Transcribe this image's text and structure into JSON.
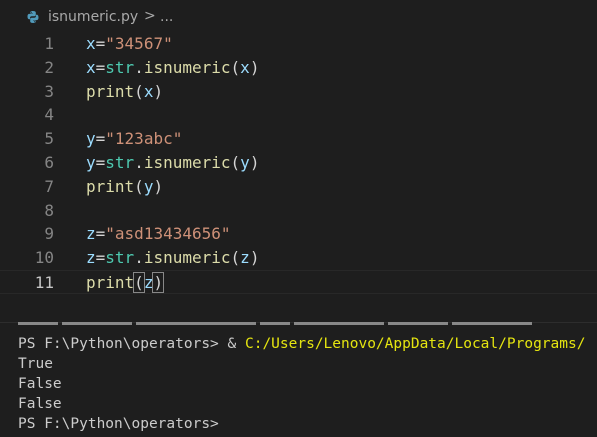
{
  "breadcrumb": {
    "icon": "python-file-icon",
    "file_name": "isnumeric.py",
    "separator": ">",
    "more": "..."
  },
  "editor": {
    "lines": [
      {
        "num": "1",
        "tokens": [
          {
            "t": "x",
            "c": "v"
          },
          {
            "t": "=",
            "c": "p"
          },
          {
            "t": "\"34567\"",
            "c": "s"
          }
        ]
      },
      {
        "num": "2",
        "tokens": [
          {
            "t": "x",
            "c": "v"
          },
          {
            "t": "=",
            "c": "p"
          },
          {
            "t": "str",
            "c": "cls"
          },
          {
            "t": ".",
            "c": "p"
          },
          {
            "t": "isnumeric",
            "c": "fn"
          },
          {
            "t": "(",
            "c": "p"
          },
          {
            "t": "x",
            "c": "v"
          },
          {
            "t": ")",
            "c": "p"
          }
        ]
      },
      {
        "num": "3",
        "tokens": [
          {
            "t": "print",
            "c": "fn"
          },
          {
            "t": "(",
            "c": "p"
          },
          {
            "t": "x",
            "c": "v"
          },
          {
            "t": ")",
            "c": "p"
          }
        ]
      },
      {
        "num": "4",
        "tokens": []
      },
      {
        "num": "5",
        "tokens": [
          {
            "t": "y",
            "c": "v"
          },
          {
            "t": "=",
            "c": "p"
          },
          {
            "t": "\"123abc\"",
            "c": "s"
          }
        ]
      },
      {
        "num": "6",
        "tokens": [
          {
            "t": "y",
            "c": "v"
          },
          {
            "t": "=",
            "c": "p"
          },
          {
            "t": "str",
            "c": "cls"
          },
          {
            "t": ".",
            "c": "p"
          },
          {
            "t": "isnumeric",
            "c": "fn"
          },
          {
            "t": "(",
            "c": "p"
          },
          {
            "t": "y",
            "c": "v"
          },
          {
            "t": ")",
            "c": "p"
          }
        ]
      },
      {
        "num": "7",
        "tokens": [
          {
            "t": "print",
            "c": "fn"
          },
          {
            "t": "(",
            "c": "p"
          },
          {
            "t": "y",
            "c": "v"
          },
          {
            "t": ")",
            "c": "p"
          }
        ]
      },
      {
        "num": "8",
        "tokens": []
      },
      {
        "num": "9",
        "tokens": [
          {
            "t": "z",
            "c": "v"
          },
          {
            "t": "=",
            "c": "p"
          },
          {
            "t": "\"asd13434656\"",
            "c": "s"
          }
        ]
      },
      {
        "num": "10",
        "tokens": [
          {
            "t": "z",
            "c": "v"
          },
          {
            "t": "=",
            "c": "p"
          },
          {
            "t": "str",
            "c": "cls"
          },
          {
            "t": ".",
            "c": "p"
          },
          {
            "t": "isnumeric",
            "c": "fn"
          },
          {
            "t": "(",
            "c": "p"
          },
          {
            "t": "z",
            "c": "v"
          },
          {
            "t": ")",
            "c": "p"
          }
        ]
      },
      {
        "num": "11",
        "tokens": [
          {
            "t": "print",
            "c": "fn"
          },
          {
            "t": "(",
            "c": "p",
            "m": true
          },
          {
            "t": "z",
            "c": "v"
          },
          {
            "t": ")",
            "c": "p",
            "m": true
          }
        ],
        "active": true
      }
    ]
  },
  "terminal": {
    "prompt1": "PS F:\\Python\\operators> ",
    "amp": "& ",
    "command": "C:/Users/Lenovo/AppData/Local/Programs/",
    "output": [
      "True",
      "False",
      "False"
    ],
    "prompt2": "PS F:\\Python\\operators> "
  },
  "colors": {
    "background": "#1e1e1e",
    "string": "#ce9178",
    "variable": "#9cdcfe",
    "function": "#dcdcaa",
    "class": "#4ec9b0",
    "command": "#e5e510"
  }
}
